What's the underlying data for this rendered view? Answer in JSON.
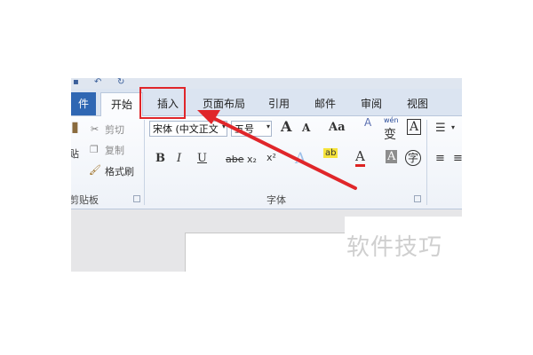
{
  "tabs": {
    "file": "件",
    "home": "开始",
    "insert": "插入",
    "page_layout": "页面布局",
    "references": "引用",
    "mailings": "邮件",
    "review": "审阅",
    "view": "视图"
  },
  "clipboard": {
    "paste_partial": "贴",
    "cut": "剪切",
    "copy": "复制",
    "format_painter": "格式刷",
    "group_label": "剪贴板"
  },
  "font": {
    "font_name": "宋体 (中文正文",
    "font_size": "五号",
    "grow": "A",
    "shrink": "A",
    "change_case": "Aa",
    "clear_format": "A",
    "phonetic": "wén",
    "phonetic_char": "变",
    "char_border": "A",
    "bold": "B",
    "italic": "I",
    "underline": "U",
    "strikethrough": "abe",
    "subscript": "x₂",
    "superscript": "x²",
    "text_effects": "A",
    "highlight": "ab",
    "font_color": "A",
    "char_shading": "A",
    "enclose": "字",
    "group_label": "字体"
  },
  "watermark": "软件技巧",
  "colors": {
    "accent": "#2f67b3",
    "highlight_box": "#e0262a"
  }
}
